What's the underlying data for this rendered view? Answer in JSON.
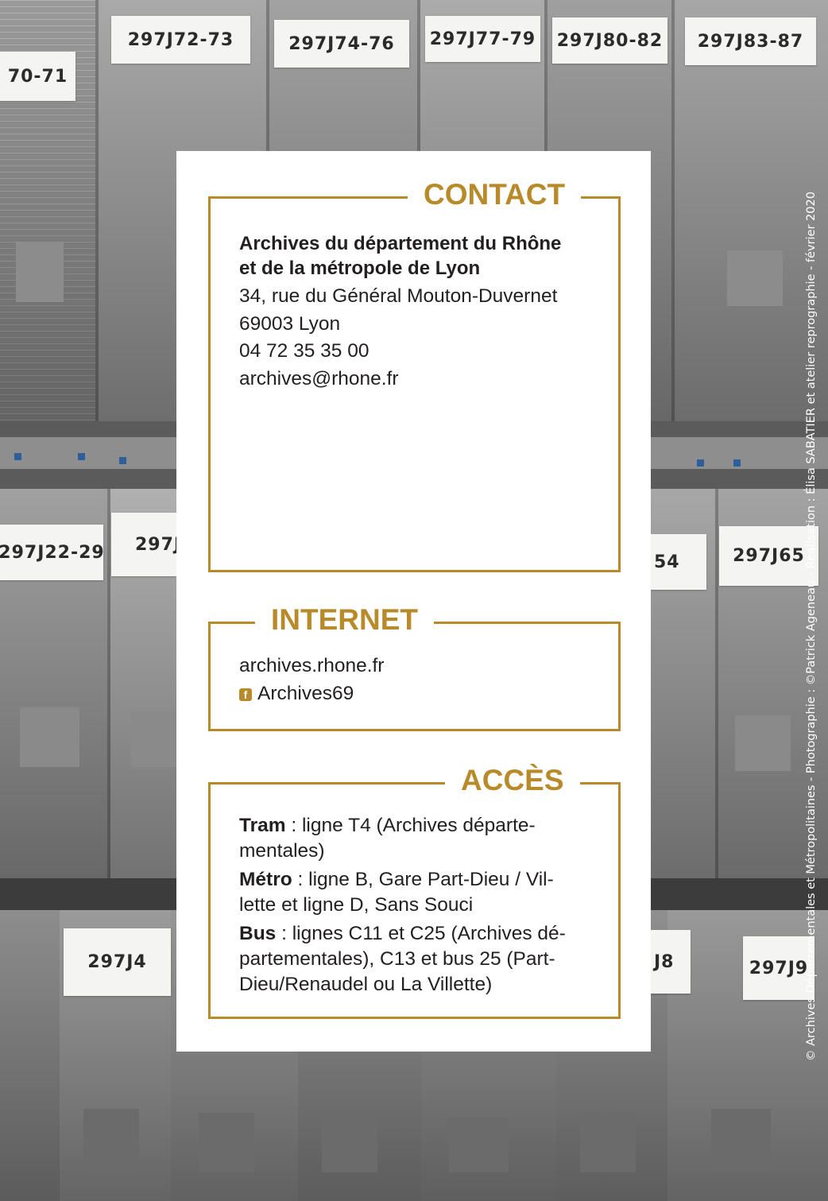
{
  "background": {
    "box_labels": [
      "297J72-73",
      "297J74-76",
      "297J77-79",
      "297J80-82",
      "297J83-87",
      "70-71",
      "297J22-29",
      "297J3",
      "54",
      "297J65",
      "297J4",
      "J8",
      "297J9"
    ]
  },
  "credit_line": "© Archives Départementales et Métropolitaines - Photographie : ©Patrick Ageneau - Réalisation : Élisa SABATIER et atelier reprographie - février 2020",
  "contact": {
    "heading": "CONTACT",
    "org_line1": "Archives du département du Rhône",
    "org_line2": "et de la métropole de Lyon",
    "address": "34, rue du Général Mouton-Duvernet",
    "city": "69003 Lyon",
    "phone": "04 72 35 35 00",
    "email": "archives@rhone.fr"
  },
  "internet": {
    "heading": "INTERNET",
    "website": "archives.rhone.fr",
    "facebook_icon": "facebook-icon",
    "facebook": "Archives69"
  },
  "acces": {
    "heading": "ACCÈS",
    "tram_label": "Tram",
    "tram_text": " : ligne T4 (Archives départe-",
    "tram_text2": "mentales)",
    "metro_label": "Métro",
    "metro_text": " : ligne B, Gare Part-Dieu / Vil-",
    "metro_text2": "lette et ligne D, Sans Souci",
    "bus_label": "Bus",
    "bus_text": " : lignes C11 et C25 (Archives dé-",
    "bus_text2": "partementales), C13 et bus 25 (Part-",
    "bus_text3": "Dieu/Renaudel ou La Villette)"
  },
  "colors": {
    "accent": "#b88a2a",
    "text": "#231f20",
    "card": "#ffffff"
  }
}
